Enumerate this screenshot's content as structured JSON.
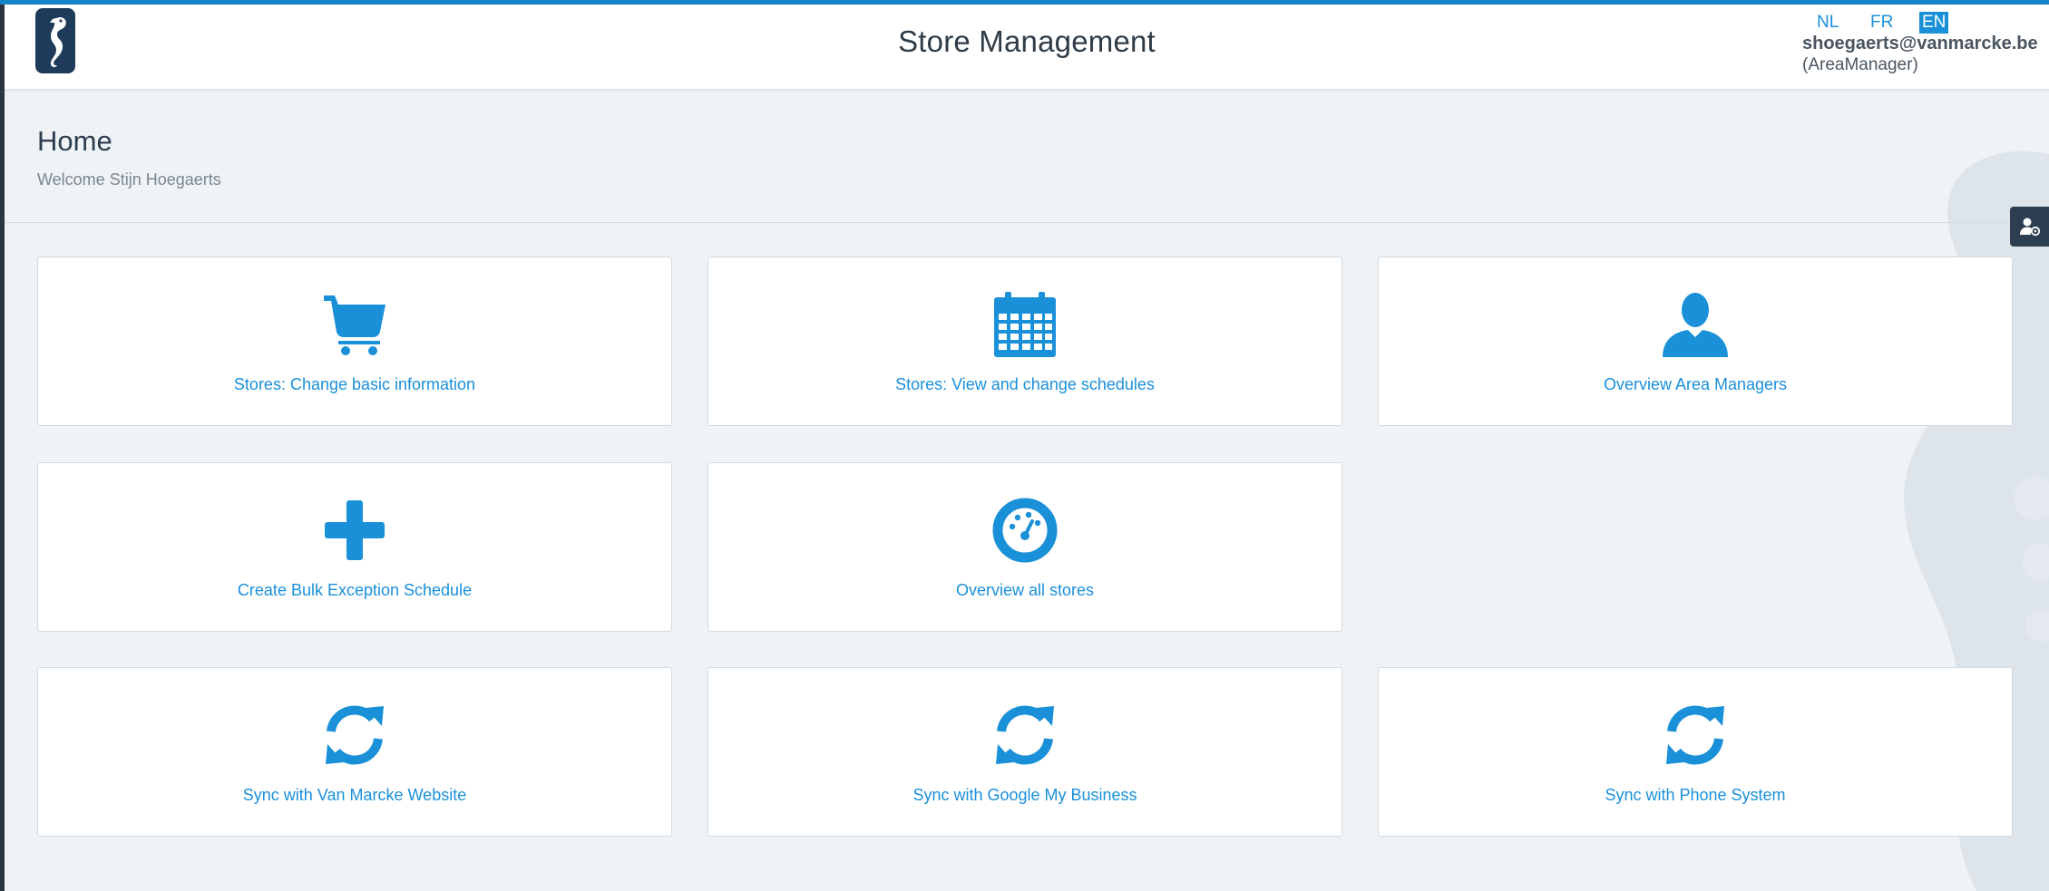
{
  "header": {
    "title": "Store Management",
    "languages": [
      "NL",
      "FR",
      "EN"
    ],
    "active_language": "EN",
    "user": {
      "email": "shoegaerts@vanmarcke.be",
      "role": "(AreaManager)"
    }
  },
  "page": {
    "title": "Home",
    "welcome": "Welcome Stijn Hoegaerts"
  },
  "tiles": [
    {
      "label": "Stores: Change basic information",
      "icon": "shopping-cart-icon"
    },
    {
      "label": "Stores: View and change schedules",
      "icon": "calendar-icon"
    },
    {
      "label": "Overview Area Managers",
      "icon": "user-icon"
    },
    {
      "label": "Create Bulk Exception Schedule",
      "icon": "plus-icon"
    },
    {
      "label": "Overview all stores",
      "icon": "dashboard-icon"
    },
    {
      "label": "Sync with Van Marcke Website",
      "icon": "refresh-icon"
    },
    {
      "label": "Sync with Google My Business",
      "icon": "refresh-icon"
    },
    {
      "label": "Sync with Phone System",
      "icon": "refresh-icon"
    }
  ],
  "colors": {
    "accent": "#1a90d8",
    "header_bg": "#ffffff",
    "page_bg": "#eff3f6",
    "dark": "#2c3e50"
  }
}
